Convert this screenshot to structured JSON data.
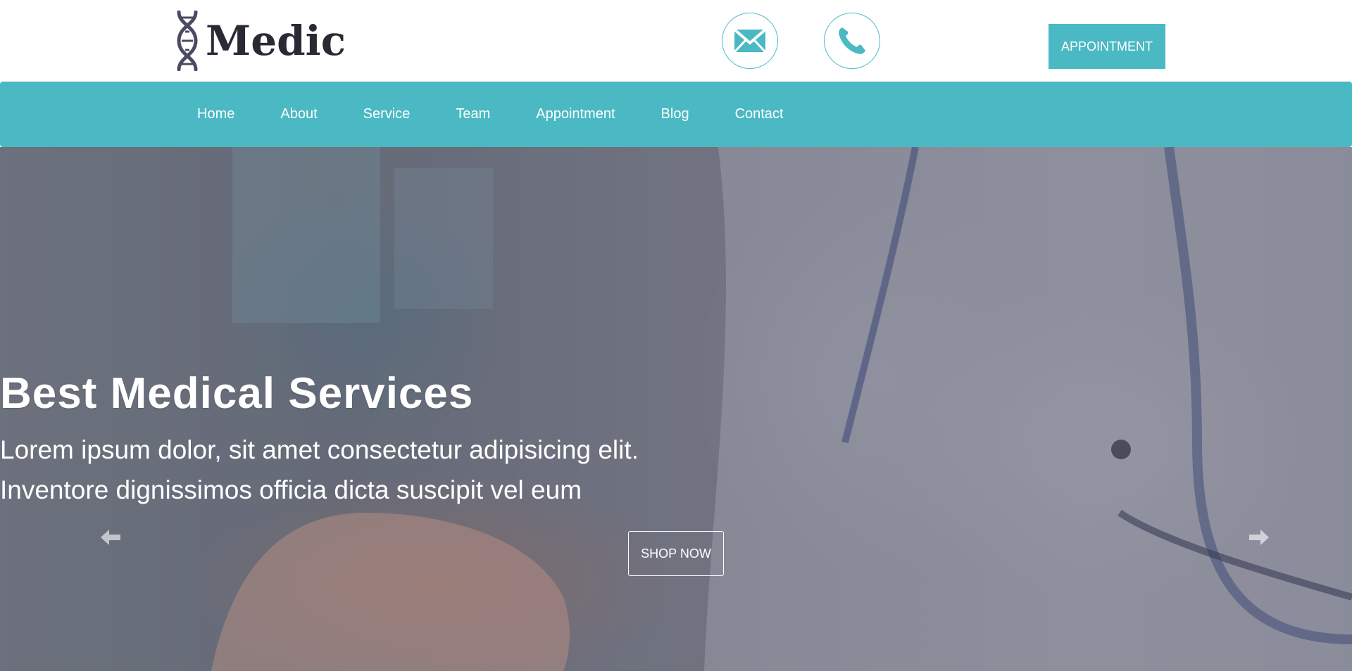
{
  "brand": {
    "name": "Medic",
    "logo_icon": "dna-icon",
    "logo_color": "#2a2a35"
  },
  "header": {
    "contact_icons": [
      "mail-icon",
      "phone-icon"
    ],
    "appointment_button": "APPOINTMENT"
  },
  "nav": {
    "items": [
      "Home",
      "About",
      "Service",
      "Team",
      "Appointment",
      "Blog",
      "Contact"
    ]
  },
  "hero": {
    "title": "Best Medical Services",
    "subtitle_line1": "Lorem ipsum dolor, sit amet consectetur adipisicing elit.",
    "subtitle_line2": "Inventore dignissimos officia dicta suscipit vel eum",
    "cta": "SHOP NOW",
    "prev_icon": "arrow-left-icon",
    "next_icon": "arrow-right-icon"
  },
  "colors": {
    "accent": "#4ab9c4",
    "white": "#ffffff"
  }
}
